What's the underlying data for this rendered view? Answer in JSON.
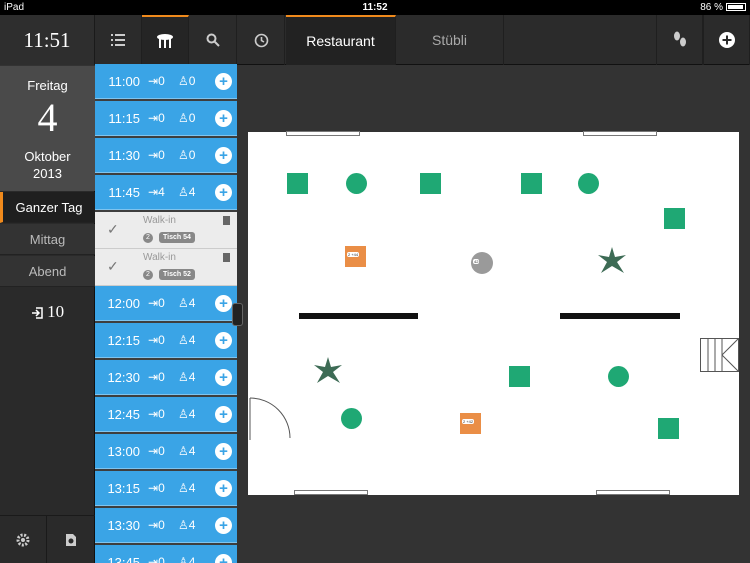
{
  "status": {
    "carrier": "iPad",
    "time": "11:52",
    "battery": "86 %"
  },
  "header": {
    "clock": "11:51",
    "tabs": [
      "Restaurant",
      "Stübli"
    ],
    "icons": [
      "list-icon",
      "table-icon",
      "search-icon",
      "history-icon",
      "footsteps-icon",
      "add-icon"
    ]
  },
  "date": {
    "weekday": "Freitag",
    "day": "4",
    "month": "Oktober",
    "year": "2013"
  },
  "periods": [
    "Ganzer Tag",
    "Mittag",
    "Abend"
  ],
  "guests_total": "10",
  "slots": [
    {
      "time": "11:00",
      "arrivals": "0",
      "people": "0"
    },
    {
      "time": "11:15",
      "arrivals": "0",
      "people": "0"
    },
    {
      "time": "11:30",
      "arrivals": "0",
      "people": "0"
    },
    {
      "time": "11:45",
      "arrivals": "4",
      "people": "4"
    },
    {
      "time": "12:00",
      "arrivals": "0",
      "people": "4"
    },
    {
      "time": "12:15",
      "arrivals": "0",
      "people": "4"
    },
    {
      "time": "12:30",
      "arrivals": "0",
      "people": "4"
    },
    {
      "time": "12:45",
      "arrivals": "0",
      "people": "4"
    },
    {
      "time": "13:00",
      "arrivals": "0",
      "people": "4"
    },
    {
      "time": "13:15",
      "arrivals": "0",
      "people": "4"
    },
    {
      "time": "13:30",
      "arrivals": "0",
      "people": "4"
    },
    {
      "time": "13:45",
      "arrivals": "0",
      "people": "4"
    }
  ],
  "reservations": [
    {
      "name": "Walk-in",
      "guests": "2",
      "table": "Tisch 54"
    },
    {
      "name": "Walk-in",
      "guests": "2",
      "table": "Tisch 52"
    }
  ],
  "floor": {
    "orange_tables": [
      {
        "badge": "2 +44"
      },
      {
        "badge": "2 +42"
      }
    ],
    "gray_table": {
      "badge": "42"
    }
  },
  "colors": {
    "accent": "#f08a1c",
    "slot": "#3aa4e6",
    "table": "#1fa874",
    "occupied": "#ea8e46"
  }
}
